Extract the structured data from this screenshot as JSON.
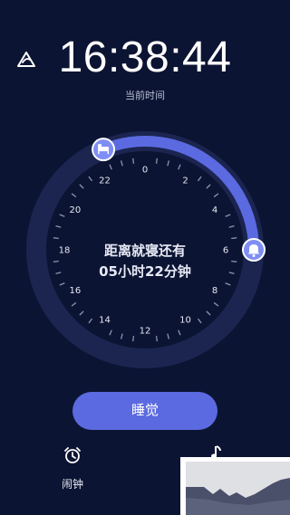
{
  "header": {
    "time": "16:38:44",
    "time_caption": "当前时间",
    "logo_icon": "leaf-triangle-icon"
  },
  "dial": {
    "hour_labels": [
      "0",
      "2",
      "4",
      "6",
      "8",
      "10",
      "12",
      "14",
      "16",
      "18",
      "20",
      "22"
    ],
    "bedtime_icon": "bed-icon",
    "alarm_icon": "bell-icon",
    "bedtime_hour": 22.5,
    "wake_hour": 6,
    "arc_color": "#5b6ae0",
    "ring_color": "#1b2550"
  },
  "countdown": {
    "line1": "距离就寝还有",
    "line2": "05小时22分钟"
  },
  "action": {
    "sleep_label": "睡觉"
  },
  "tabs": {
    "alarm_label": "闹钟",
    "alarm_icon": "alarm-clock-icon",
    "music_icon": "music-note-icon"
  }
}
